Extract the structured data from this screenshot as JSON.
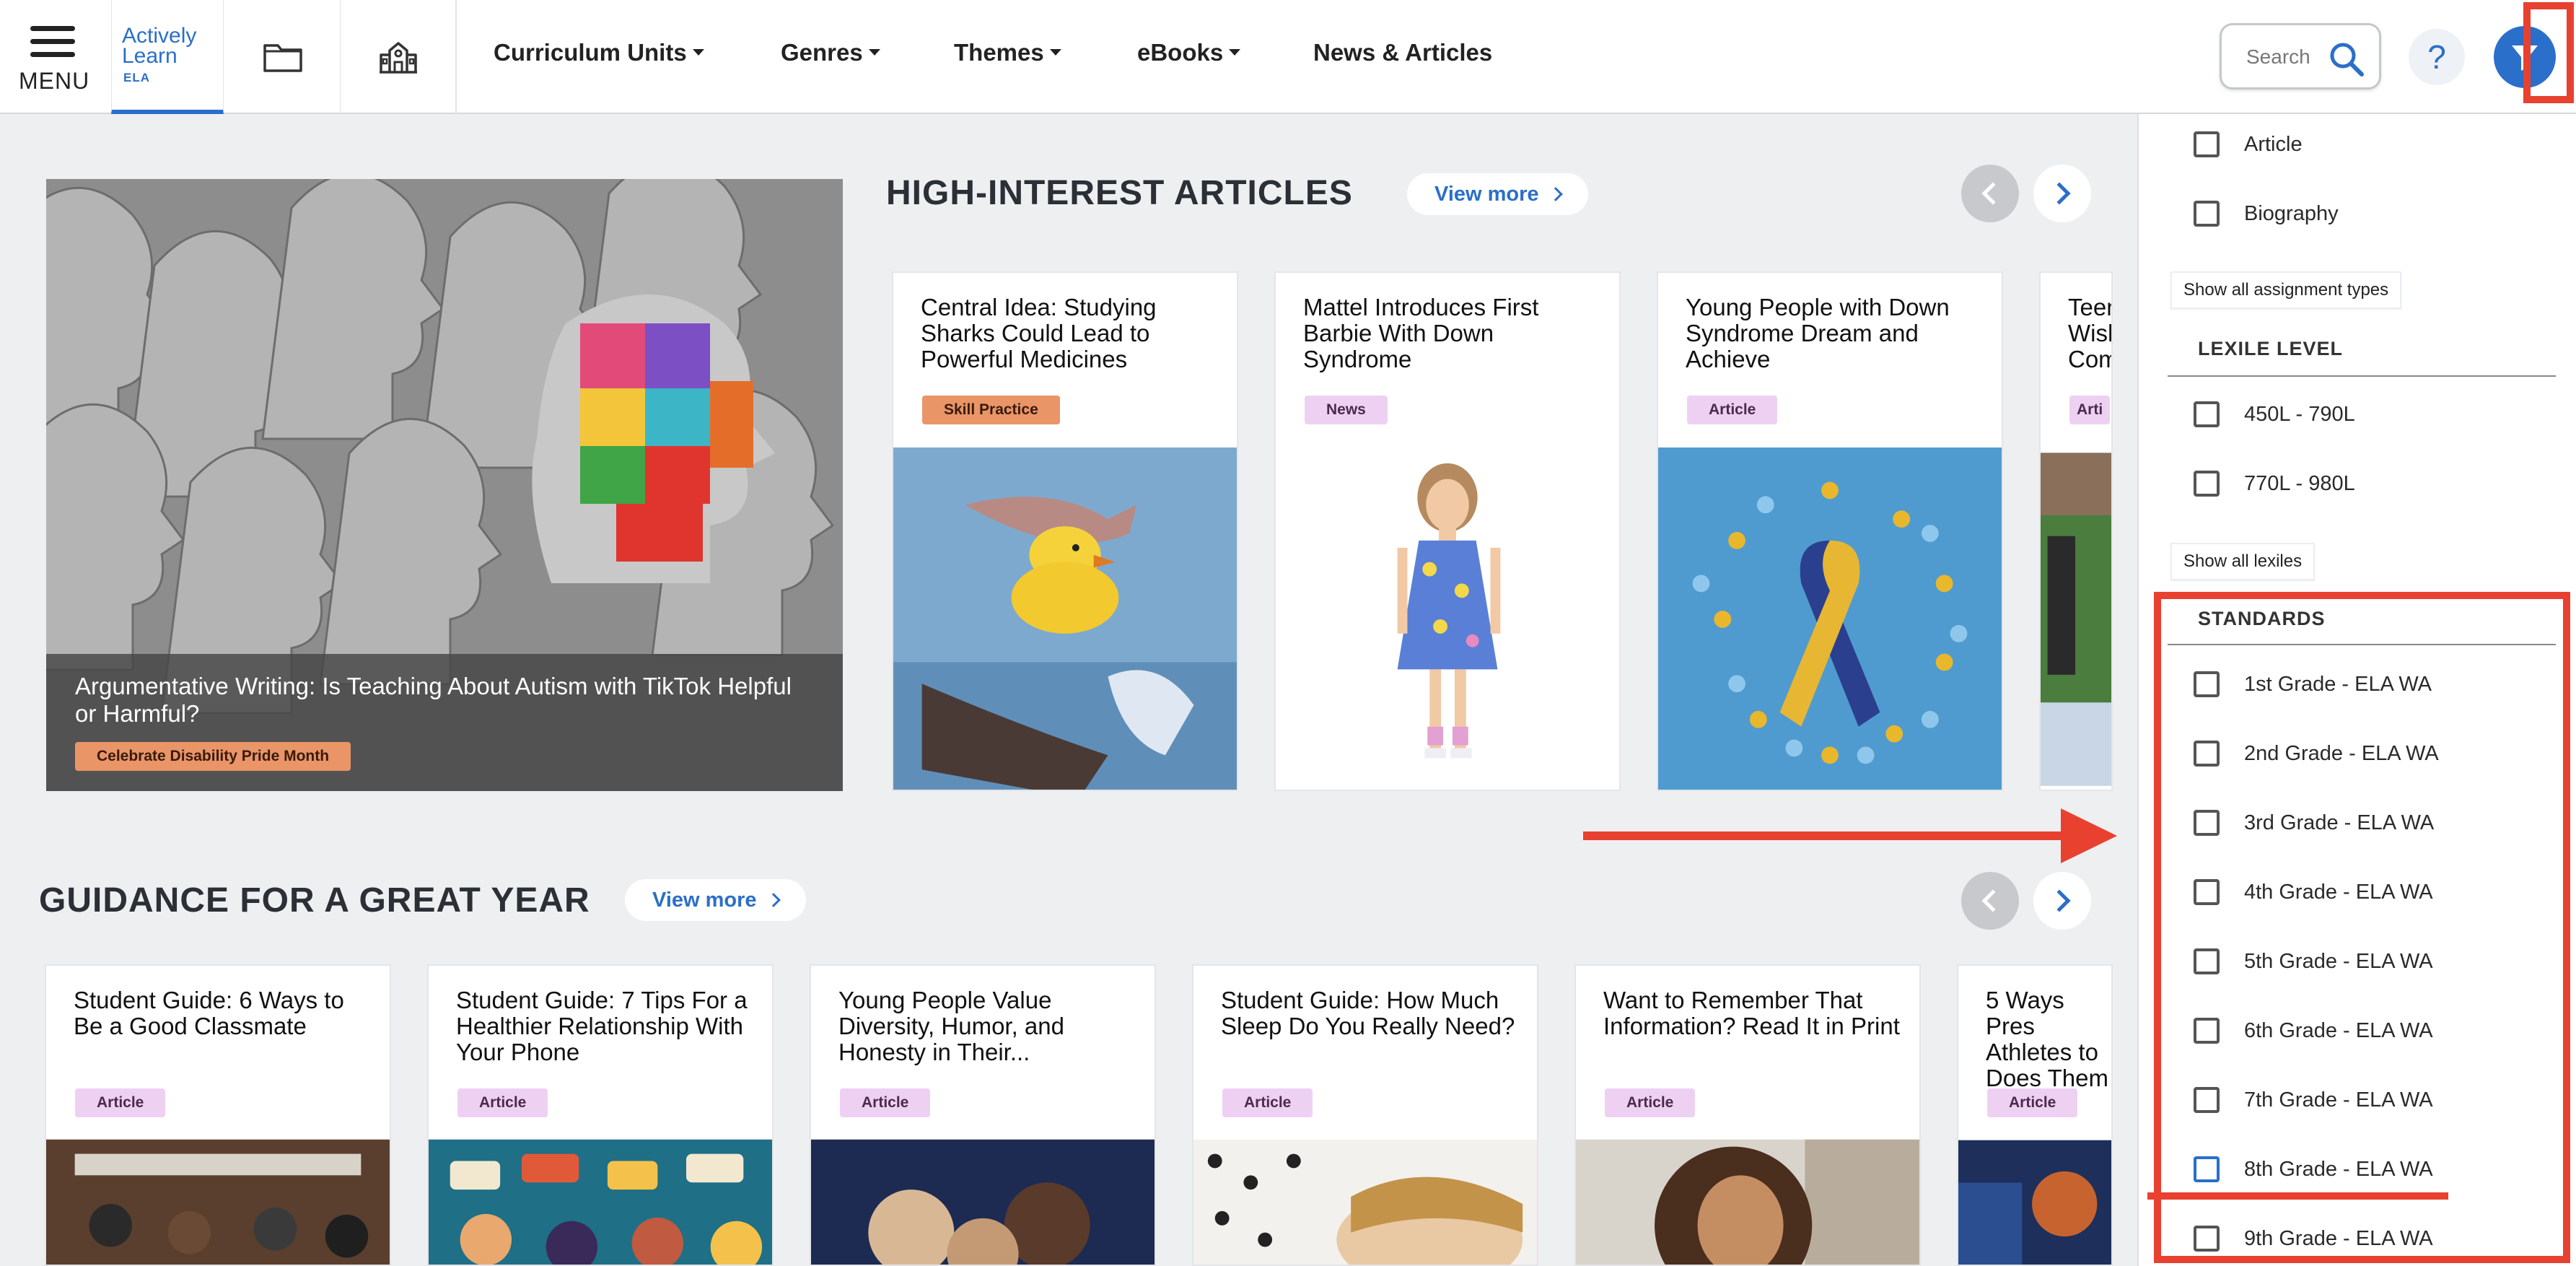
{
  "header": {
    "menu_label": "MENU",
    "logo": {
      "line1": "Actively",
      "line2": "Learn",
      "tag": "ELA"
    },
    "nav": [
      {
        "label": "Curriculum Units",
        "dropdown": true
      },
      {
        "label": "Genres",
        "dropdown": true
      },
      {
        "label": "Themes",
        "dropdown": true
      },
      {
        "label": "eBooks",
        "dropdown": true
      },
      {
        "label": "News & Articles",
        "dropdown": false
      }
    ],
    "search_placeholder": "Search",
    "help_label": "?"
  },
  "hero": {
    "title": "Argumentative Writing: Is Teaching About Autism with TikTok Helpful or Harmful?",
    "tag": "Celebrate Disability Pride Month"
  },
  "section1": {
    "title": "HIGH-INTEREST ARTICLES",
    "view_more": "View more",
    "cards": [
      {
        "title": "Central Idea: Studying Sharks Could Lead to Powerful Medicines",
        "tag": "Skill Practice",
        "tag_style": "orange"
      },
      {
        "title": "Mattel Introduces First Barbie With Down Syndrome",
        "tag": "News",
        "tag_style": "pink"
      },
      {
        "title": "Young People with Down Syndrome Dream and Achieve",
        "tag": "Article",
        "tag_style": "pink"
      },
      {
        "title": "Teen Wish Com",
        "tag": "Arti",
        "tag_style": "pink"
      }
    ]
  },
  "section2": {
    "title": "GUIDANCE FOR A GREAT YEAR",
    "view_more": "View more",
    "cards": [
      {
        "title": "Student Guide: 6 Ways to Be a Good Classmate",
        "tag": "Article"
      },
      {
        "title": "Student Guide: 7 Tips For a Healthier Relationship With Your Phone",
        "tag": "Article"
      },
      {
        "title": "Young People Value Diversity, Humor, and Honesty in Their...",
        "tag": "Article"
      },
      {
        "title": "Student Guide: How Much Sleep Do You Really Need?",
        "tag": "Article"
      },
      {
        "title": "Want to Remember That Information? Read It in Print",
        "tag": "Article"
      },
      {
        "title": "5 Ways Pres Athletes to Does Them",
        "tag": "Article"
      }
    ]
  },
  "filters": {
    "assignment_types": [
      "Article",
      "Biography"
    ],
    "show_all_assignment": "Show all assignment types",
    "lexile_heading": "LEXILE LEVEL",
    "lexiles": [
      "450L - 790L",
      "770L - 980L"
    ],
    "show_all_lexiles": "Show all lexiles",
    "standards_heading": "STANDARDS",
    "standards": [
      "1st Grade - ELA WA",
      "2nd Grade - ELA WA",
      "3rd Grade - ELA WA",
      "4th Grade - ELA WA",
      "5th Grade - ELA WA",
      "6th Grade - ELA WA",
      "7th Grade - ELA WA",
      "8th Grade - ELA WA",
      "9th Grade - ELA WA"
    ]
  },
  "colors": {
    "accent": "#2a6fc9",
    "annotation_red": "#e8412f",
    "tag_orange": "#e99568",
    "tag_pink": "#eed1f2"
  }
}
